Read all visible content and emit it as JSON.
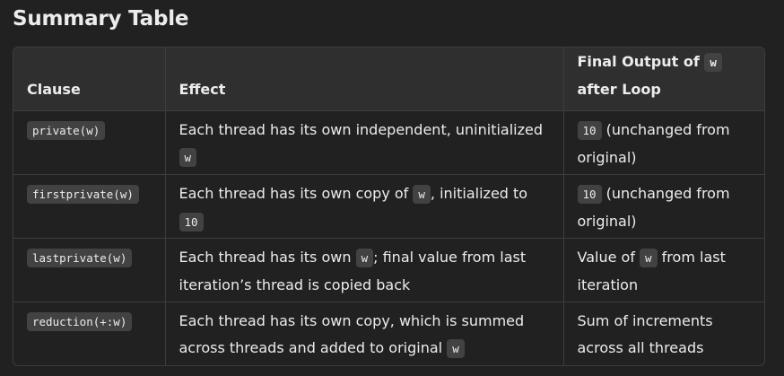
{
  "section_title": "Summary Table",
  "table": {
    "headers": {
      "clause": "Clause",
      "effect": "Effect",
      "final_pre": "Final Output of",
      "final_code": "w",
      "final_post": "after Loop"
    },
    "rows": [
      {
        "clause": "private(w)",
        "effect_a": "Each thread has its own independent, uninitialized",
        "effect_code1": "w",
        "effect_b": "",
        "effect_code2": "",
        "effect_c": "",
        "final_code": "10",
        "final_text": "(unchanged from original)"
      },
      {
        "clause": "firstprivate(w)",
        "effect_a": "Each thread has its own copy of",
        "effect_code1": "w",
        "effect_b": ", initialized to",
        "effect_code2": "10",
        "effect_c": "",
        "final_code": "10",
        "final_text": "(unchanged from original)"
      },
      {
        "clause": "lastprivate(w)",
        "effect_a": "Each thread has its own",
        "effect_code1": "w",
        "effect_b": "; final value from last iteration’s thread is copied back",
        "effect_code2": "",
        "effect_c": "",
        "final_pre": "Value of",
        "final_code": "w",
        "final_text": "from last iteration"
      },
      {
        "clause": "reduction(+:w)",
        "effect_a": "Each thread has its own copy, which is summed across threads and added to original",
        "effect_code1": "w",
        "effect_b": "",
        "effect_code2": "",
        "effect_c": "",
        "final_text": "Sum of increments across all threads"
      }
    ]
  }
}
